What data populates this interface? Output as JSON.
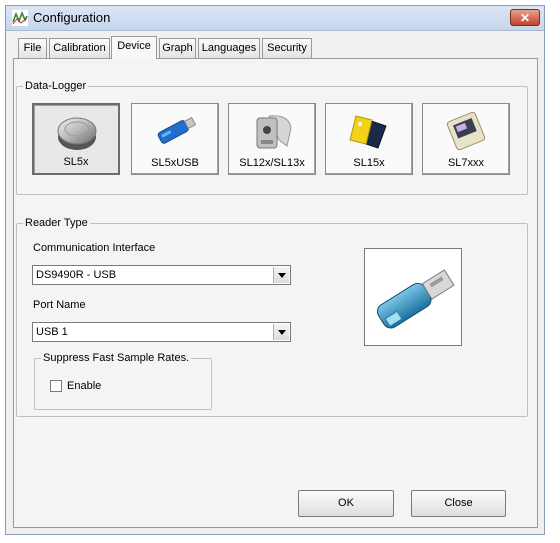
{
  "window": {
    "title": "Configuration",
    "close_glyph": "✕"
  },
  "tabs": [
    {
      "label": "File"
    },
    {
      "label": "Calibration"
    },
    {
      "label": "Device",
      "active": true
    },
    {
      "label": "Graph"
    },
    {
      "label": "Languages"
    },
    {
      "label": "Security"
    }
  ],
  "data_logger": {
    "legend": "Data-Logger",
    "devices": [
      {
        "label": "SL5x",
        "icon": "coin-cell-logger-icon",
        "selected": true
      },
      {
        "label": "SL5xUSB",
        "icon": "usb-stick-logger-icon"
      },
      {
        "label": "SL12x/SL13x",
        "icon": "tag-logger-icon"
      },
      {
        "label": "SL15x",
        "icon": "keyfob-logger-icon"
      },
      {
        "label": "SL7xxx",
        "icon": "card-logger-icon"
      }
    ]
  },
  "reader_type": {
    "legend": "Reader Type",
    "communication_interface": {
      "label": "Communication Interface",
      "value": "DS9490R - USB"
    },
    "port_name": {
      "label": "Port Name",
      "value": "USB 1"
    },
    "suppress": {
      "legend": "Suppress Fast Sample Rates.",
      "checkbox_label": "Enable",
      "checked": false
    },
    "reader_image_icon": "usb-reader-adapter-icon"
  },
  "buttons": {
    "ok": "OK",
    "close": "Close"
  },
  "colors": {
    "accent": "#2a7fb0",
    "close_button": "#c5432c"
  }
}
